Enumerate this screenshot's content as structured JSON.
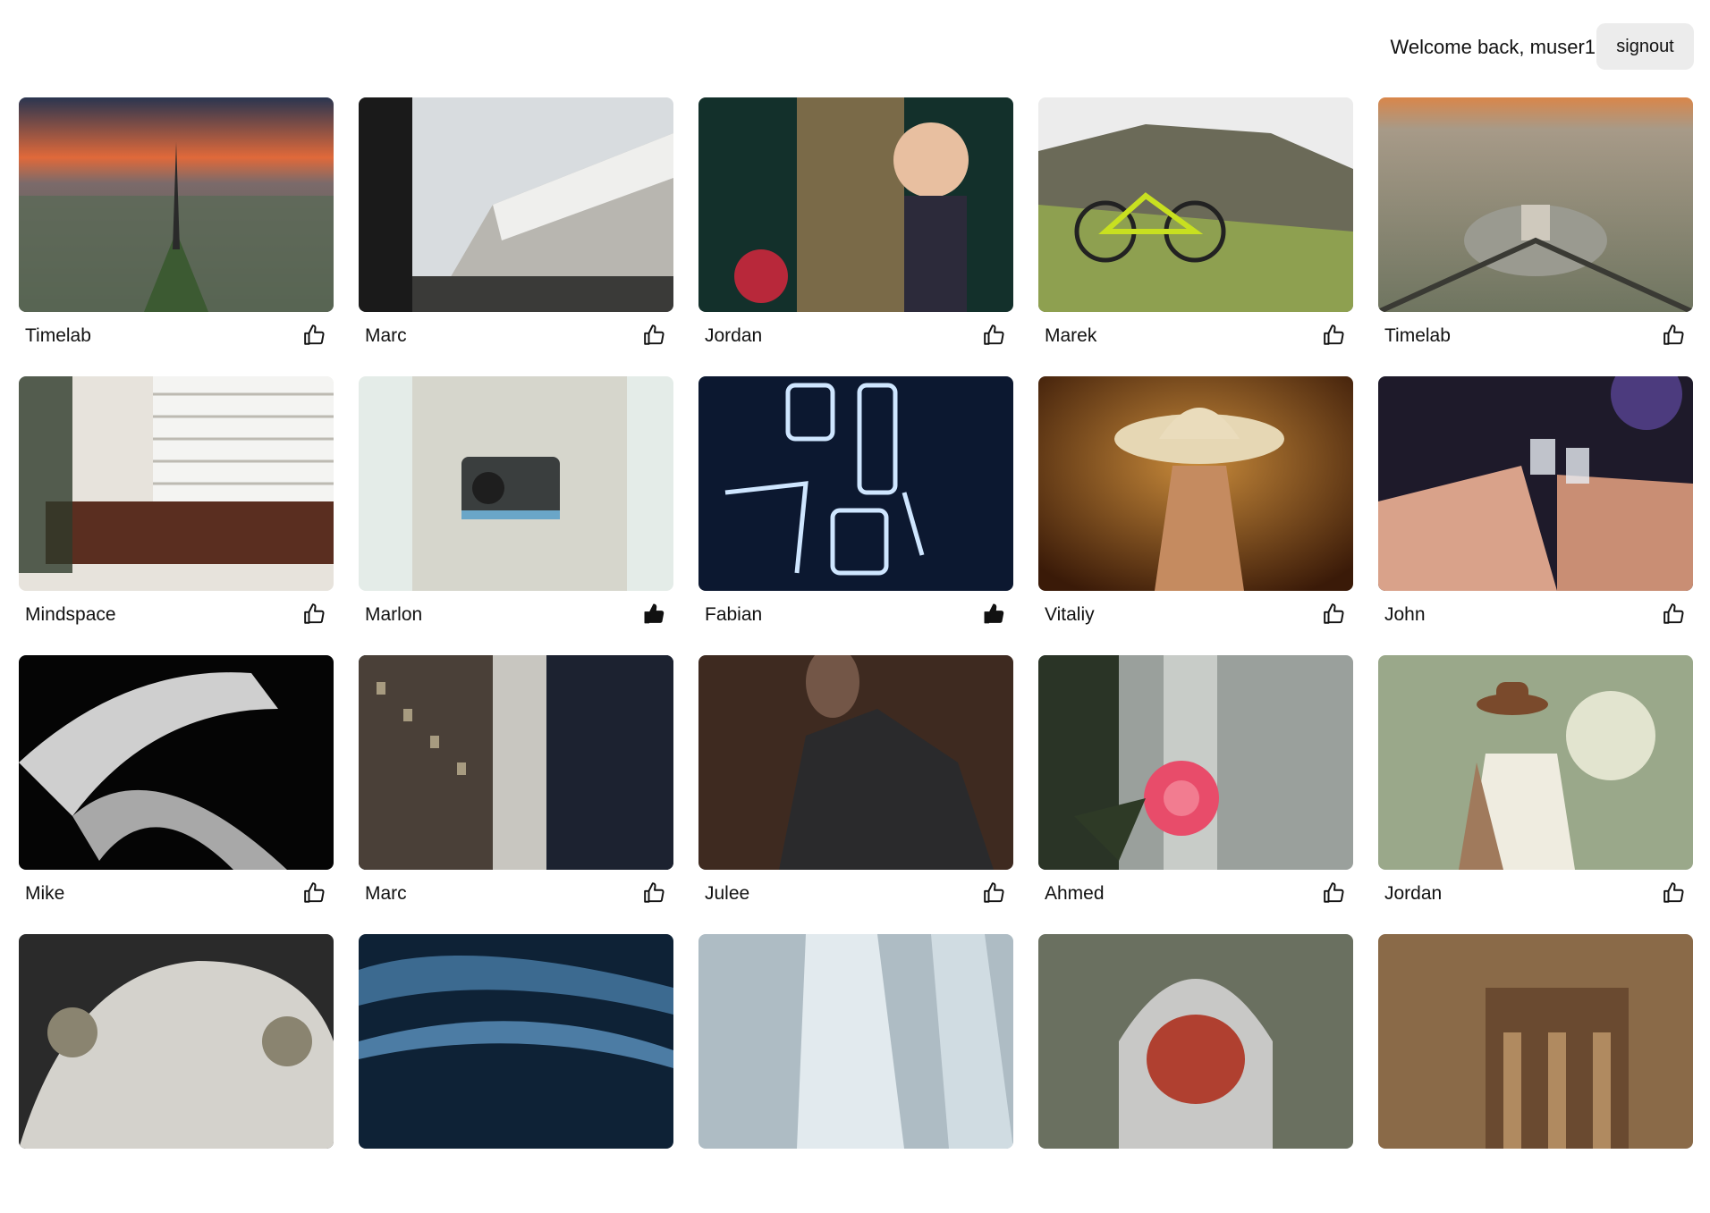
{
  "header": {
    "welcome_text": "Welcome back, muser1",
    "signout_label": "signout"
  },
  "photos": [
    {
      "author": "Timelab",
      "liked": false,
      "scene": "paris-eiffel-sunset"
    },
    {
      "author": "Marc",
      "liked": false,
      "scene": "cruise-ship"
    },
    {
      "author": "Jordan",
      "liked": false,
      "scene": "mother-with-baby"
    },
    {
      "author": "Marek",
      "liked": false,
      "scene": "bicycle-on-hill"
    },
    {
      "author": "Timelab",
      "liked": false,
      "scene": "paris-arc-de-triomphe"
    },
    {
      "author": "Mindspace",
      "liked": false,
      "scene": "lounge-sofa"
    },
    {
      "author": "Marlon",
      "liked": true,
      "scene": "woman-with-camera"
    },
    {
      "author": "Fabian",
      "liked": true,
      "scene": "neon-sign"
    },
    {
      "author": "Vitaliy",
      "liked": false,
      "scene": "woman-cowboy-hat"
    },
    {
      "author": "John",
      "liked": false,
      "scene": "toast-shots"
    },
    {
      "author": "Mike",
      "liked": false,
      "scene": "spiral-staircase"
    },
    {
      "author": "Marc",
      "liked": false,
      "scene": "city-buildings"
    },
    {
      "author": "Julee",
      "liked": false,
      "scene": "woman-dark-coat"
    },
    {
      "author": "Ahmed",
      "liked": false,
      "scene": "pink-flower"
    },
    {
      "author": "Jordan",
      "liked": false,
      "scene": "woman-brown-hat"
    },
    {
      "author": "",
      "liked": false,
      "scene": "vintage-car"
    },
    {
      "author": "",
      "liked": false,
      "scene": "blue-waves"
    },
    {
      "author": "",
      "liked": false,
      "scene": "waterfall"
    },
    {
      "author": "",
      "liked": false,
      "scene": "hooded-figure"
    },
    {
      "author": "",
      "liked": false,
      "scene": "petra-ruins"
    }
  ],
  "colors": {
    "signout_bg": "#ececec",
    "text": "#111111"
  }
}
